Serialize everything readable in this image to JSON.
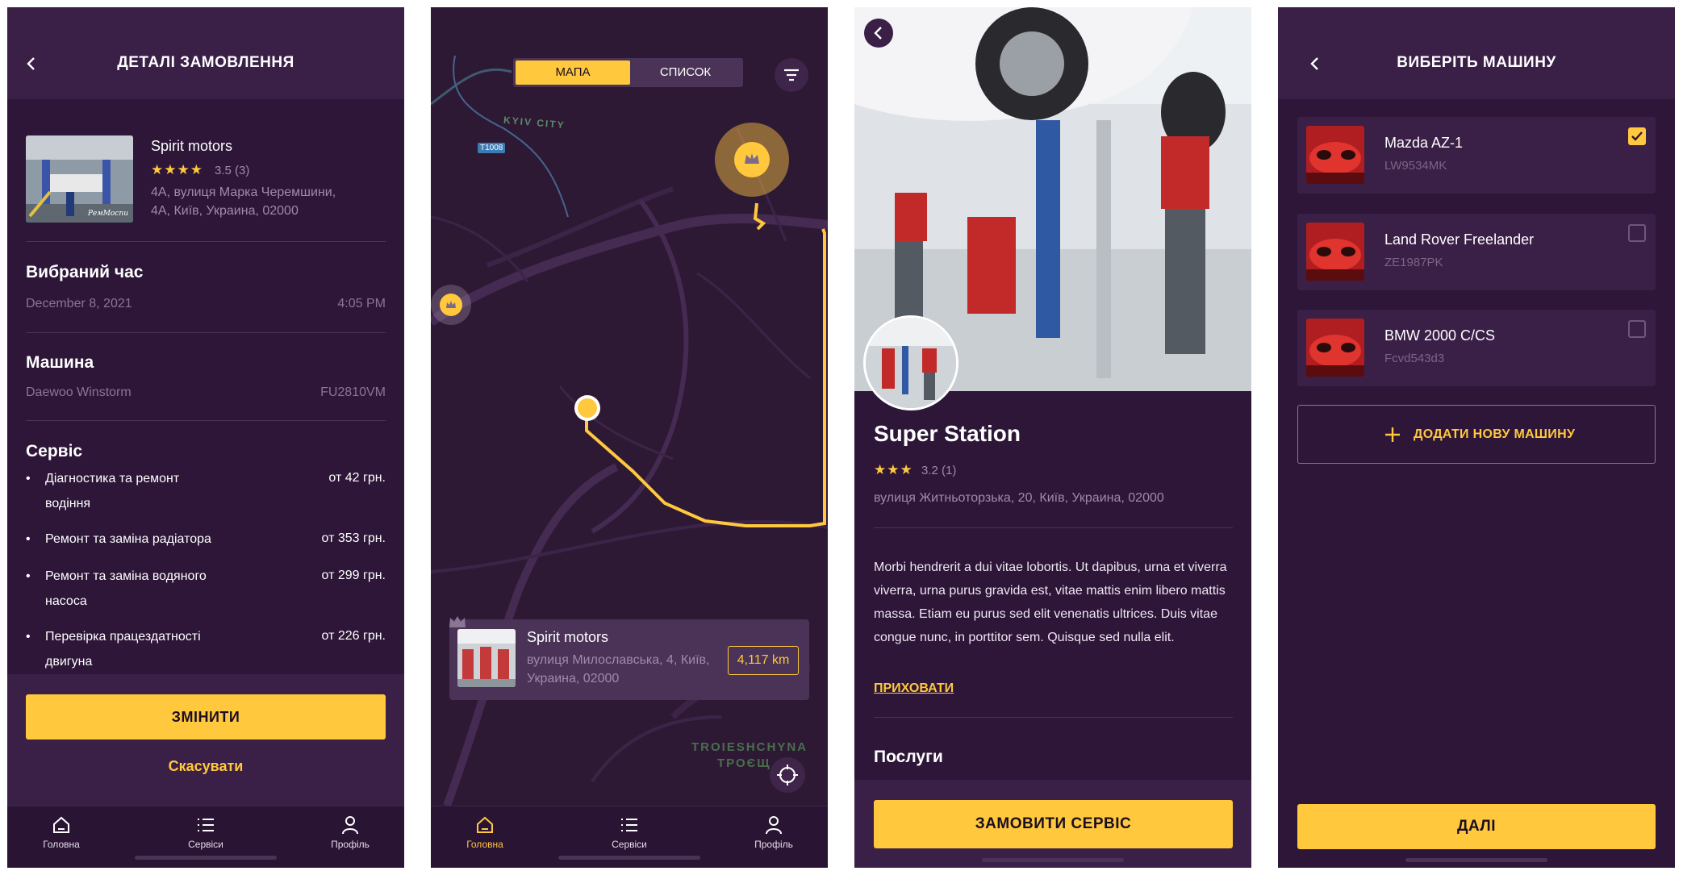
{
  "colors": {
    "bg": "#2d1638",
    "header": "#3a1f47",
    "accent": "#ffc83d",
    "muted": "#8b7595"
  },
  "nav": {
    "home": "Головна",
    "services": "Сервіси",
    "profile": "Профіль"
  },
  "screen1": {
    "title": "ДЕТАЛІ ЗАМОВЛЕННЯ",
    "shop": {
      "name": "Spirit motors",
      "stars": "★★★★",
      "rating": "3.5 (3)",
      "address1": "4А, вулиця Марка Черемшини,",
      "address2": "4А, Київ, Украина, 02000",
      "thumb_caption": "РемМоспи"
    },
    "time": {
      "title": "Вибраний час",
      "date": "December 8, 2021",
      "time": "4:05 PM"
    },
    "car": {
      "title": "Машина",
      "name": "Daewoo Winstorm",
      "plate": "FU2810VM"
    },
    "service": {
      "title": "Сервіс",
      "items": [
        {
          "line1": "Діагностика та ремонт",
          "line2": "водіння",
          "price": "от 42 грн."
        },
        {
          "line1": "Ремонт та заміна радіатора",
          "line2": "",
          "price": "от 353 грн."
        },
        {
          "line1": "Ремонт та заміна водяного",
          "line2": "насоса",
          "price": "от 299 грн."
        },
        {
          "line1": "Перевірка працездатності",
          "line2": "двигуна",
          "price": "от 226 грн."
        }
      ]
    },
    "change_label": "ЗМІНИТИ",
    "cancel_label": "Скасувати"
  },
  "screen2": {
    "tab_map": "МАПА",
    "tab_list": "СПИСОК",
    "label_kyiv_city": "KYIV CITY",
    "label_road": "T1008",
    "label_district_lat": "TROIESHCHYNA",
    "label_district_cyr": "ТРОЄЩ",
    "card": {
      "name": "Spirit motors",
      "address1": "вулиця Милославська, 4, Київ,",
      "address2": "Украина, 02000",
      "distance": "4,117 km"
    }
  },
  "screen3": {
    "name": "Super Station",
    "stars": "★★★",
    "rating": "3.2 (1)",
    "address": "вулиця Житньоторзька, 20, Київ, Украина, 02000",
    "description": "Morbi hendrerit a dui vitae lobortis. Ut dapibus, urna et viverra viverra, urna purus gravida est, vitae mattis enim libero mattis massa. Etiam eu purus sed elit venenatis ultrices. Duis vitae congue nunc, in porttitor sem. Quisque sed nulla elit.",
    "hide_label": "ПРИХОВАТИ",
    "services_title": "Послуги",
    "order_label": "ЗАМОВИТИ СЕРВІС"
  },
  "screen4": {
    "title": "ВИБЕРІТЬ МАШИНУ",
    "cars": [
      {
        "name": "Mazda AZ-1",
        "plate": "LW9534MK",
        "checked": true
      },
      {
        "name": "Land Rover Freelander",
        "plate": "ZE1987PK",
        "checked": false
      },
      {
        "name": "BMW 2000 C/CS",
        "plate": "Fcvd543d3",
        "checked": false
      }
    ],
    "add_label": "ДОДАТИ НОВУ МАШИНУ",
    "next_label": "ДАЛІ"
  }
}
